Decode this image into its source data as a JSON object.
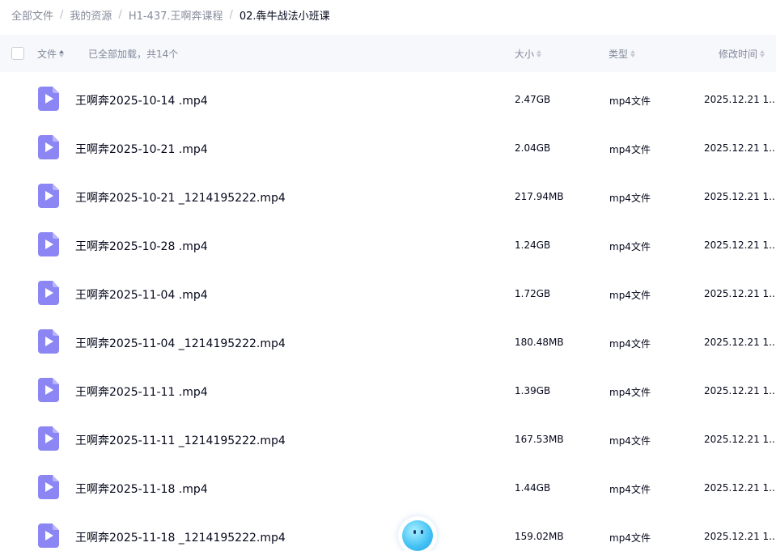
{
  "breadcrumb": {
    "items": [
      "全部文件",
      "我的资源",
      "H1-437.王啊奔课程",
      "02.犇牛战法小班课"
    ],
    "separator": "/"
  },
  "header": {
    "name_label": "文件",
    "status": "已全部加载，共14个",
    "size_label": "大小",
    "type_label": "类型",
    "time_label": "修改时间"
  },
  "files": [
    {
      "name": "王啊奔2025-10-14 .mp4",
      "size": "2.47GB",
      "type": "mp4文件",
      "modified": "2025.12.21 1..."
    },
    {
      "name": "王啊奔2025-10-21 .mp4",
      "size": "2.04GB",
      "type": "mp4文件",
      "modified": "2025.12.21 1..."
    },
    {
      "name": "王啊奔2025-10-21 _1214195222.mp4",
      "size": "217.94MB",
      "type": "mp4文件",
      "modified": "2025.12.21 1..."
    },
    {
      "name": "王啊奔2025-10-28 .mp4",
      "size": "1.24GB",
      "type": "mp4文件",
      "modified": "2025.12.21 1..."
    },
    {
      "name": "王啊奔2025-11-04 .mp4",
      "size": "1.72GB",
      "type": "mp4文件",
      "modified": "2025.12.21 1..."
    },
    {
      "name": "王啊奔2025-11-04 _1214195222.mp4",
      "size": "180.48MB",
      "type": "mp4文件",
      "modified": "2025.12.21 1..."
    },
    {
      "name": "王啊奔2025-11-11 .mp4",
      "size": "1.39GB",
      "type": "mp4文件",
      "modified": "2025.12.21 1..."
    },
    {
      "name": "王啊奔2025-11-11 _1214195222.mp4",
      "size": "167.53MB",
      "type": "mp4文件",
      "modified": "2025.12.21 1..."
    },
    {
      "name": "王啊奔2025-11-18 .mp4",
      "size": "1.44GB",
      "type": "mp4文件",
      "modified": "2025.12.21 1..."
    },
    {
      "name": "王啊奔2025-11-18 _1214195222.mp4",
      "size": "159.02MB",
      "type": "mp4文件",
      "modified": "2025.12.21 1..."
    }
  ],
  "colors": {
    "accent_icon": "#8b86f3",
    "header_bg": "#f6f8fc",
    "muted_text": "#878c9c"
  },
  "icons": {
    "file": "video-file-icon",
    "assistant": "assistant-avatar-icon"
  }
}
